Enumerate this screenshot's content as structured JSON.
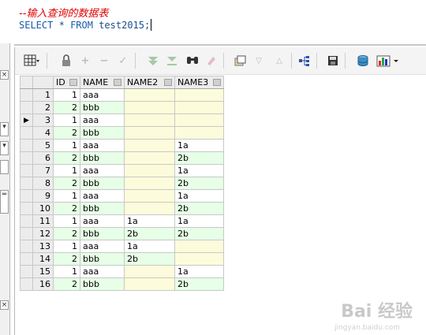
{
  "editor": {
    "comment": "--输入查询的数据表",
    "sql_keyword_select": "SELECT",
    "sql_star": "*",
    "sql_keyword_from": "FROM",
    "sql_table": "test2015;"
  },
  "toolbar": {
    "icons": [
      "grid-icon",
      "lock-icon",
      "add-icon",
      "remove-icon",
      "check-icon",
      "filter-icon",
      "filter-clear-icon",
      "find-icon",
      "clear-icon",
      "export-icon",
      "nav-down-icon",
      "nav-up-icon",
      "tree-icon",
      "save-icon",
      "db-icon",
      "chart-icon"
    ]
  },
  "left_strip": {
    "labels": [
      "×",
      "×"
    ]
  },
  "grid": {
    "columns": [
      "ID",
      "NAME",
      "NAME2",
      "NAME3"
    ],
    "current_row_marker": "▶",
    "rows": [
      {
        "num": "1",
        "id": "1",
        "name": "aaa",
        "name2": "",
        "name3": ""
      },
      {
        "num": "2",
        "id": "2",
        "name": "bbb",
        "name2": "",
        "name3": ""
      },
      {
        "num": "3",
        "id": "1",
        "name": "aaa",
        "name2": "",
        "name3": ""
      },
      {
        "num": "4",
        "id": "2",
        "name": "bbb",
        "name2": "",
        "name3": ""
      },
      {
        "num": "5",
        "id": "1",
        "name": "aaa",
        "name2": "",
        "name3": "1a"
      },
      {
        "num": "6",
        "id": "2",
        "name": "bbb",
        "name2": "",
        "name3": "2b"
      },
      {
        "num": "7",
        "id": "1",
        "name": "aaa",
        "name2": "",
        "name3": "1a"
      },
      {
        "num": "8",
        "id": "2",
        "name": "bbb",
        "name2": "",
        "name3": "2b"
      },
      {
        "num": "9",
        "id": "1",
        "name": "aaa",
        "name2": "",
        "name3": "1a"
      },
      {
        "num": "10",
        "id": "2",
        "name": "bbb",
        "name2": "",
        "name3": "2b"
      },
      {
        "num": "11",
        "id": "1",
        "name": "aaa",
        "name2": "1a",
        "name3": "1a"
      },
      {
        "num": "12",
        "id": "2",
        "name": "bbb",
        "name2": "2b",
        "name3": "2b"
      },
      {
        "num": "13",
        "id": "1",
        "name": "aaa",
        "name2": "1a",
        "name3": ""
      },
      {
        "num": "14",
        "id": "2",
        "name": "bbb",
        "name2": "2b",
        "name3": ""
      },
      {
        "num": "15",
        "id": "1",
        "name": "aaa",
        "name2": "",
        "name3": "1a"
      },
      {
        "num": "16",
        "id": "2",
        "name": "bbb",
        "name2": "",
        "name3": "2b"
      }
    ]
  },
  "watermark": {
    "text": "Bai 经验",
    "sub": "jingyan.baidu.com"
  }
}
